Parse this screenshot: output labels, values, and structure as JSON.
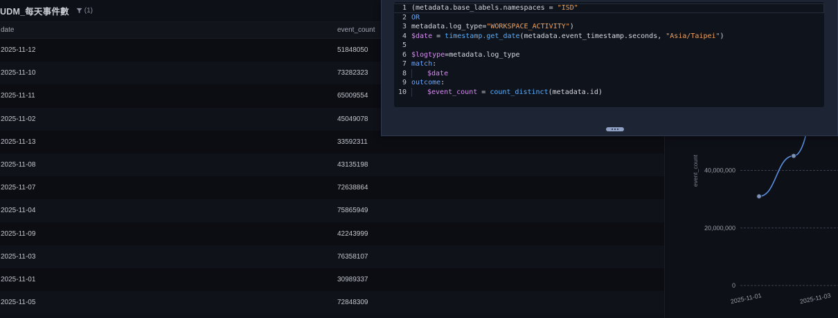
{
  "table": {
    "title": "UDM_每天事件數",
    "filter_badge": "(1)",
    "columns": [
      "date",
      "event_count"
    ],
    "rows": [
      [
        "2025-11-12",
        "51848050"
      ],
      [
        "2025-11-10",
        "73282323"
      ],
      [
        "2025-11-11",
        "65009554"
      ],
      [
        "2025-11-02",
        "45049078"
      ],
      [
        "2025-11-13",
        "33592311"
      ],
      [
        "2025-11-08",
        "43135198"
      ],
      [
        "2025-11-07",
        "72638864"
      ],
      [
        "2025-11-04",
        "75865949"
      ],
      [
        "2025-11-09",
        "42243999"
      ],
      [
        "2025-11-03",
        "76358107"
      ],
      [
        "2025-11-01",
        "30989337"
      ],
      [
        "2025-11-05",
        "72848309"
      ]
    ]
  },
  "editor": {
    "lines": [
      {
        "n": "1",
        "parts": [
          [
            "t",
            "(metadata.base_labels.namespaces = "
          ],
          [
            "s",
            "\"ISD\""
          ]
        ]
      },
      {
        "n": "2",
        "parts": [
          [
            "k",
            "OR"
          ]
        ]
      },
      {
        "n": "3",
        "parts": [
          [
            "t",
            "metadata.log_type="
          ],
          [
            "s",
            "\"WORKSPACE_ACTIVITY\""
          ],
          [
            "t",
            ")"
          ]
        ]
      },
      {
        "n": "4",
        "parts": [
          [
            "v",
            "$date"
          ],
          [
            "t",
            " = "
          ],
          [
            "f",
            "timestamp.get_date"
          ],
          [
            "t",
            "(metadata.event_timestamp.seconds, "
          ],
          [
            "s",
            "\"Asia/Taipei\""
          ],
          [
            "t",
            ")"
          ]
        ]
      },
      {
        "n": "5",
        "parts": []
      },
      {
        "n": "6",
        "parts": [
          [
            "v",
            "$logtype"
          ],
          [
            "t",
            "=metadata.log_type"
          ]
        ]
      },
      {
        "n": "7",
        "parts": [
          [
            "k",
            "match"
          ],
          [
            "t",
            ":"
          ]
        ]
      },
      {
        "n": "8",
        "parts": [
          [
            "g",
            ""
          ],
          [
            "v",
            "$date"
          ]
        ]
      },
      {
        "n": "9",
        "parts": [
          [
            "k",
            "outcome"
          ],
          [
            "t",
            ":"
          ]
        ]
      },
      {
        "n": "10",
        "parts": [
          [
            "g",
            ""
          ],
          [
            "v",
            "$event_count"
          ],
          [
            "t",
            " = "
          ],
          [
            "f",
            "count_distinct"
          ],
          [
            "t",
            "(metadata.id)"
          ]
        ]
      }
    ]
  },
  "chart_data": {
    "type": "line",
    "ylabel": "event_count",
    "y_ticks": [
      "0",
      "20,000,000",
      "40,000,000"
    ],
    "x_ticks": [
      "2025-11-01",
      "2025-11-03"
    ],
    "x": [
      "2025-11-01",
      "2025-11-02",
      "2025-11-03"
    ],
    "values": [
      30989337,
      45049078,
      76358107
    ],
    "ylim": [
      0,
      80000000
    ],
    "grid": true,
    "colors": {
      "line": "#5a8fe0",
      "point": "#7f95b8"
    }
  }
}
